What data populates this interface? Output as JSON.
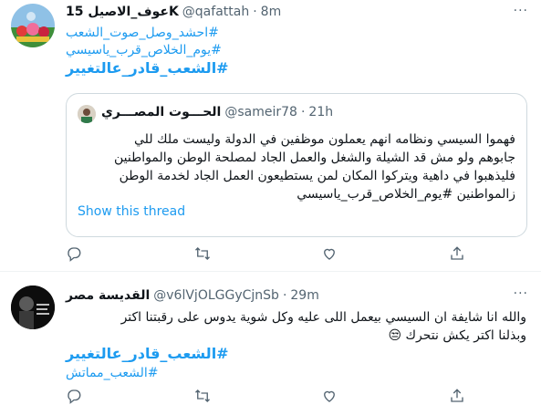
{
  "tweet1": {
    "name": "عوف_الاصيل 15K",
    "handle": "@qafattah",
    "dot": "·",
    "time": "8m",
    "more": "···",
    "hashtags": [
      "#احشد_وصل_صوت_الشعب",
      "#يوم_الخلاص_قرب_ياسيسي",
      "#الشعب_قادر_عالتغيير"
    ],
    "quote": {
      "name": "الحـــوت المصـــري",
      "handle": "@sameir78",
      "dot": "·",
      "time": "21h",
      "lines": [
        "فهموا السيسي ونظامه انهم يعملون موظفين في الدولة وليست ملك للي",
        "جابوهم ولو مش قد الشيلة والشغل والعمل الجاد لمصلحة الوطن والمواطنين",
        "فليذهبوا في داهية ويتركوا المكان لمن يستطيعون العمل الجاد لخدمة الوطن",
        "زالمواطنين #يوم_الخلاص_قرب_ياسيسي"
      ],
      "show_thread": "Show this thread"
    }
  },
  "tweet2": {
    "name": "القديسة مصر",
    "handle": "@v6lVjOLGGyCjnSb",
    "dot": "·",
    "time": "29m",
    "more": "···",
    "lines": [
      "والله انا شايفة ان السيسي بيعمل اللى عليه وكل شوية يدوس على رقبتنا اكتر",
      "وبذلنا اكتر يكش نتحرك 😒"
    ],
    "hashtags": [
      "#الشعب_قادر_عالتغيير",
      "#الشعب_مماتش"
    ]
  },
  "icons": {
    "reply": "reply-icon",
    "retweet": "retweet-icon",
    "like": "like-icon",
    "share": "share-icon"
  },
  "colors": {
    "link": "#1d9bf0",
    "secondary": "#536471",
    "border": "#cfd9de"
  }
}
